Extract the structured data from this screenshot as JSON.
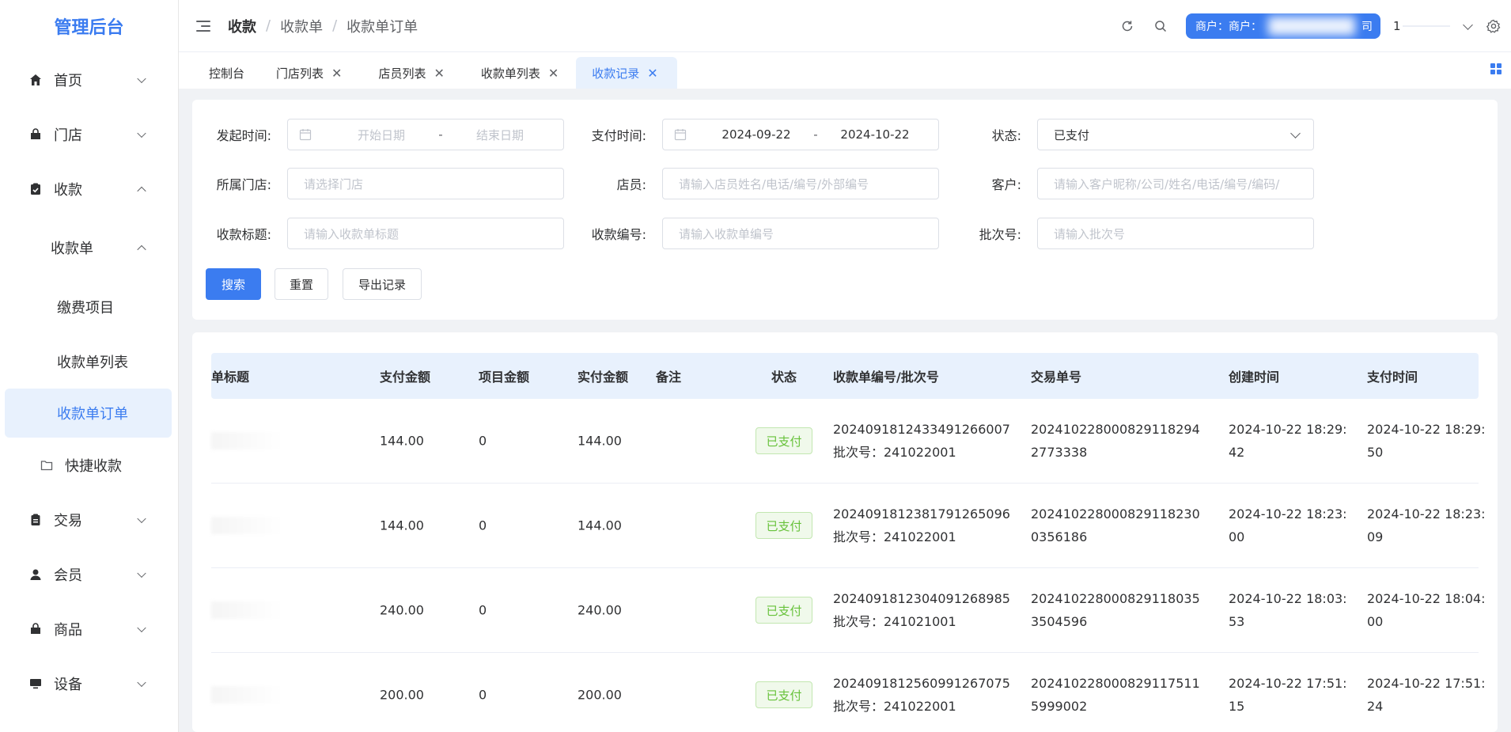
{
  "app": {
    "title": "管理后台"
  },
  "sidebar": {
    "items": [
      {
        "label": "首页",
        "icon": "home-icon"
      },
      {
        "label": "门店",
        "icon": "store-icon"
      },
      {
        "label": "收款",
        "icon": "clipboard-check-icon"
      },
      {
        "label": "收款单"
      },
      {
        "label": "缴费项目"
      },
      {
        "label": "收款单列表"
      },
      {
        "label": "收款单订单"
      },
      {
        "label": "快捷收款",
        "icon": "folder-icon"
      },
      {
        "label": "交易",
        "icon": "clipboard-icon"
      },
      {
        "label": "会员",
        "icon": "user-icon"
      },
      {
        "label": "商品",
        "icon": "bag-icon"
      },
      {
        "label": "设备",
        "icon": "monitor-icon"
      }
    ]
  },
  "header": {
    "breadcrumb": [
      "收款",
      "收款单",
      "收款单订单"
    ],
    "merchant_label": "商户：商户：",
    "merchant_tail": "司",
    "user": "1"
  },
  "tabs": [
    {
      "label": "控制台"
    },
    {
      "label": "门店列表"
    },
    {
      "label": "店员列表"
    },
    {
      "label": "收款单列表"
    },
    {
      "label": "收款记录"
    }
  ],
  "filters": {
    "start_time_label": "发起时间:",
    "start_date_placeholder": "开始日期",
    "end_date_placeholder": "结束日期",
    "range_sep": "-",
    "pay_time_label": "支付时间:",
    "pay_start": "2024-09-22",
    "pay_end": "2024-10-22",
    "status_label": "状态:",
    "status_value": "已支付",
    "store_label": "所属门店:",
    "store_placeholder": "请选择门店",
    "clerk_label": "店员:",
    "clerk_placeholder": "请输入店员姓名/电话/编号/外部编号",
    "customer_label": "客户:",
    "customer_placeholder": "请输入客户昵称/公司/姓名/电话/编号/编码/",
    "title_label": "收款标题:",
    "title_placeholder": "请输入收款单标题",
    "code_label": "收款编号:",
    "code_placeholder": "请输入收款单编号",
    "batch_label": "批次号:",
    "batch_placeholder": "请输入批次号",
    "search_btn": "搜索",
    "reset_btn": "重置",
    "export_btn": "导出记录"
  },
  "table": {
    "headers": [
      "单标题",
      "支付金额",
      "项目金额",
      "实付金额",
      "备注",
      "状态",
      "收款单编号/批次号",
      "交易单号",
      "创建时间",
      "支付时间"
    ],
    "rows": [
      {
        "pay": "144.00",
        "item": "0",
        "actual": "144.00",
        "status": "已支付",
        "code": "20240918124334912660​07",
        "batch": "批次号：241022001",
        "trade": "2024102280008291182942773338",
        "created": "2024-10-22 18:29:42",
        "paid": "2024-10-22 18:29:50",
        "prefix": ""
      },
      {
        "pay": "144.00",
        "item": "0",
        "actual": "144.00",
        "status": "已支付",
        "code": "20240918123817912650​96",
        "batch": "批次号：241022001",
        "trade": "2024102280008291182300356186",
        "created": "2024-10-22 18:23:00",
        "paid": "2024-10-22 18:23:09",
        "prefix": ""
      },
      {
        "pay": "240.00",
        "item": "0",
        "actual": "240.00",
        "status": "已支付",
        "code": "20240918123040912689​85",
        "batch": "批次号：241021001",
        "trade": "2024102280008291180353504596",
        "created": "2024-10-22 18:03:53",
        "paid": "2024-10-22 18:04:00",
        "prefix": ""
      },
      {
        "pay": "200.00",
        "item": "0",
        "actual": "200.00",
        "status": "已支付",
        "code": "20240918125609912670​75",
        "batch": "批次号：241022001",
        "trade": "2024102280008291175115999002",
        "created": "2024-10-22 17:51:15",
        "paid": "2024-10-22 17:51:24",
        "prefix": "​"
      }
    ]
  },
  "colors": {
    "primary": "#3b7cf0",
    "success": "#67c23a",
    "header_bg": "#e8f1fd"
  }
}
